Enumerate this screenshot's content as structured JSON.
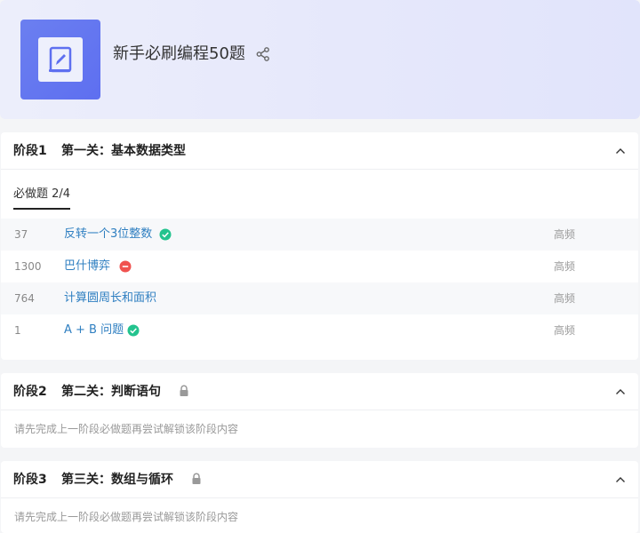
{
  "header": {
    "title": "新手必刷编程50题"
  },
  "stages": [
    {
      "stage_label": "阶段1",
      "stage_name": "第一关：基本数据类型",
      "tab_label": "必做题 2/4",
      "problems": [
        {
          "id": "37",
          "name": "反转一个3位整数",
          "status": "done",
          "freq": "高频"
        },
        {
          "id": "1300",
          "name": "巴什博弈",
          "status": "failed",
          "freq": "高频"
        },
        {
          "id": "764",
          "name": "计算圆周长和面积",
          "status": "none",
          "freq": "高频"
        },
        {
          "id": "1",
          "name": "A + B 问题",
          "status": "done",
          "freq": "高频"
        }
      ]
    },
    {
      "stage_label": "阶段2",
      "stage_name": "第二关：判断语句",
      "locked": true,
      "hint": "请先完成上一阶段必做题再尝试解锁该阶段内容"
    },
    {
      "stage_label": "阶段3",
      "stage_name": "第三关：数组与循环",
      "locked": true,
      "hint": "请先完成上一阶段必做题再尝试解锁该阶段内容"
    }
  ],
  "colors": {
    "accent": "#5e6ff0",
    "link": "#2f7fc1",
    "success": "#23c38e",
    "error": "#f0524f"
  },
  "icons": {
    "cover": "book-edit-icon",
    "share": "share-icon",
    "collapse": "chevron-up-icon",
    "lock": "lock-icon",
    "done": "check-circle-icon",
    "failed": "minus-circle-icon"
  }
}
